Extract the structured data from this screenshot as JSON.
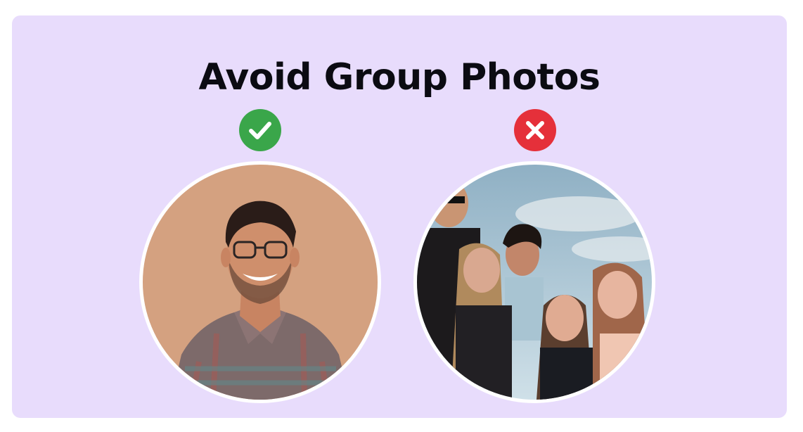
{
  "header": {
    "title": "Avoid Group Photos"
  },
  "examples": [
    {
      "verdict": "correct",
      "icon": "check-circle-icon",
      "color": "#3aa64a",
      "subject": "single person portrait"
    },
    {
      "verdict": "incorrect",
      "icon": "x-circle-icon",
      "color": "#e5303a",
      "subject": "group photo"
    }
  ],
  "colors": {
    "background": "#e8dcfc",
    "title": "#0b0b12",
    "check": "#3aa64a",
    "cross": "#e5303a"
  }
}
